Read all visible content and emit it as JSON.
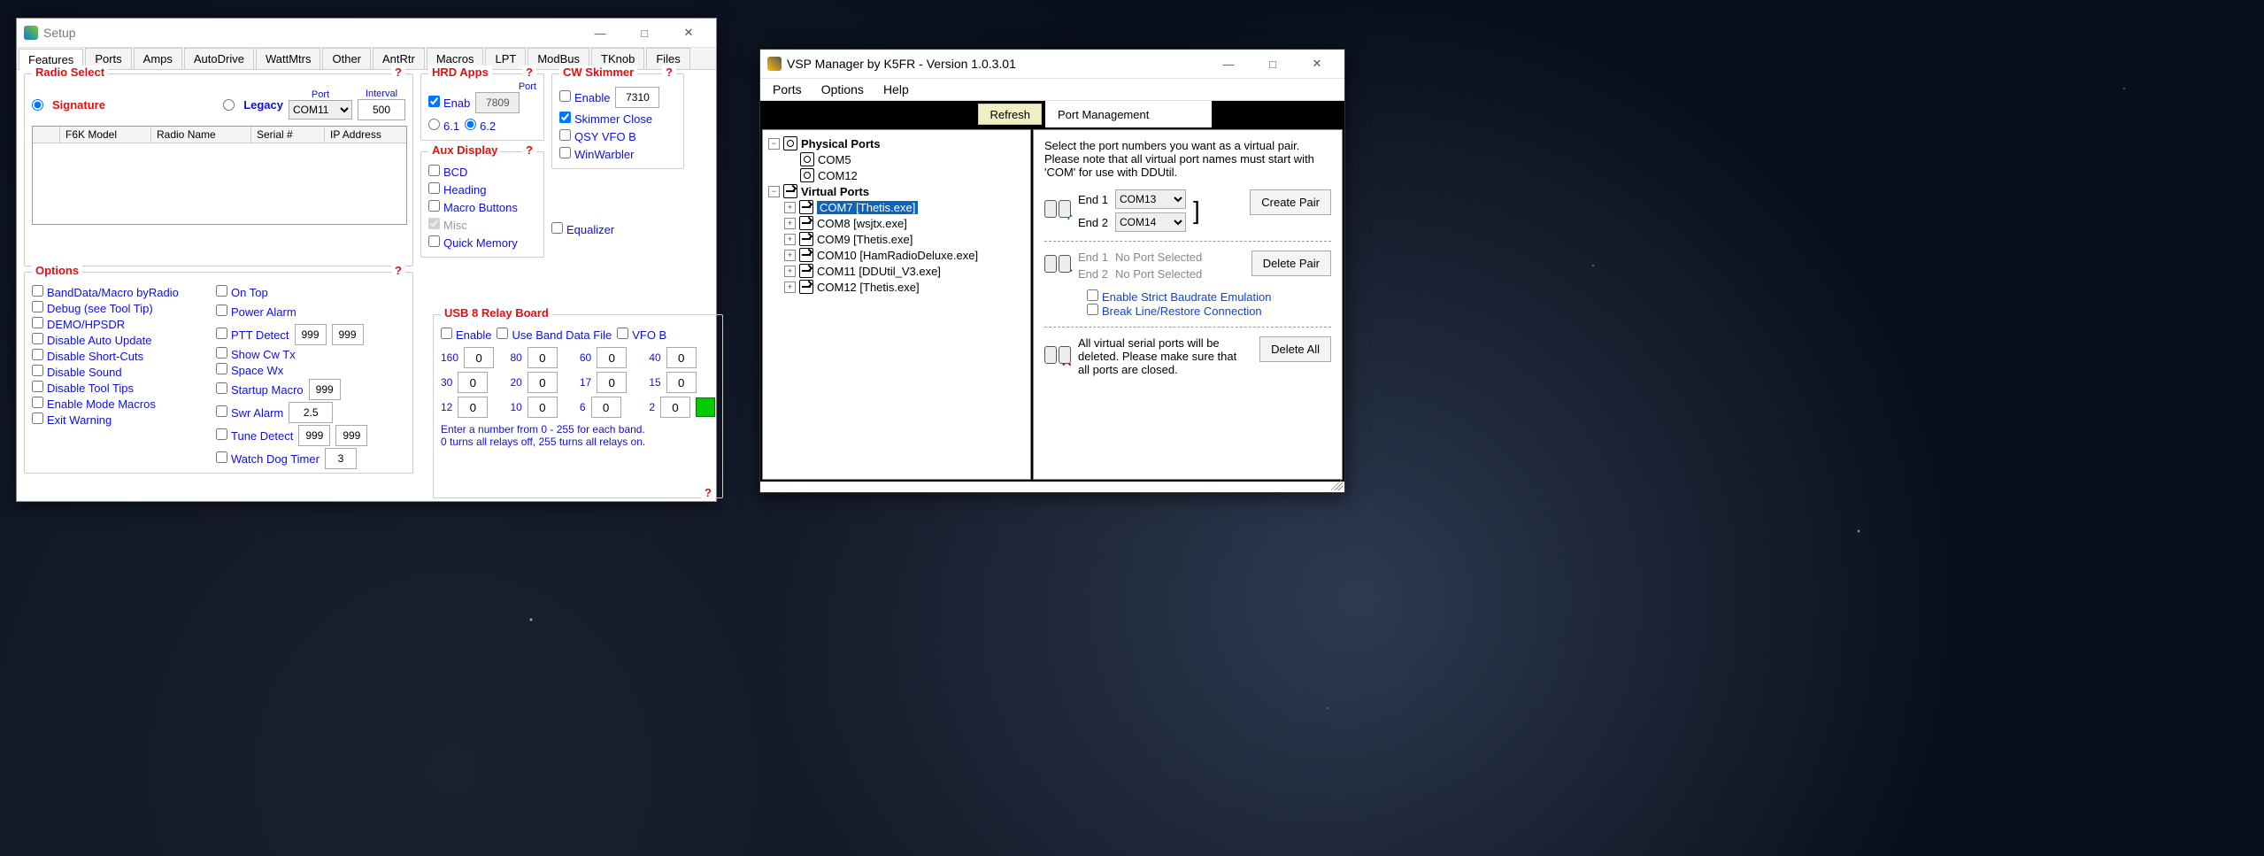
{
  "setup": {
    "title": "Setup",
    "tabs": [
      "Features",
      "Ports",
      "Amps",
      "AutoDrive",
      "WattMtrs",
      "Other",
      "AntRtr",
      "Macros",
      "LPT",
      "ModBus",
      "TKnob",
      "Files"
    ],
    "radio_select": {
      "title": "Radio Select",
      "signature": "Signature",
      "legacy": "Legacy",
      "port_label": "Port",
      "port": "COM11",
      "interval_label": "Interval",
      "interval": "500",
      "table_cols": {
        "col1": "",
        "col2": "F6K Model",
        "col3": "Radio Name",
        "col4": "Serial #",
        "col5": "IP Address"
      }
    },
    "options": {
      "title": "Options",
      "left": [
        "BandData/Macro byRadio",
        "Debug (see Tool Tip)",
        "DEMO/HPSDR",
        "Disable Auto Update",
        "Disable Short-Cuts",
        "Disable Sound",
        "Disable Tool Tips",
        "Enable Mode Macros",
        "Exit Warning"
      ],
      "right": {
        "on_top": "On Top",
        "power_alarm": "Power Alarm",
        "ptt_detect": "PTT Detect",
        "ptt1": "999",
        "ptt2": "999",
        "show_cw": "Show Cw Tx",
        "space_wx": "Space Wx",
        "startup_macro": "Startup Macro",
        "startup_val": "999",
        "swr_alarm": "Swr Alarm",
        "swr_val": "2.5",
        "tune_detect": "Tune Detect",
        "tune1": "999",
        "tune2": "999",
        "watchdog": "Watch Dog Timer",
        "watchdog_val": "3"
      }
    },
    "hrd": {
      "title": "HRD Apps",
      "port_label": "Port",
      "enab": "Enab",
      "port": "7809",
      "v61": "6.1",
      "v62": "6.2"
    },
    "aux": {
      "title": "Aux Display",
      "bcd": "BCD",
      "heading": "Heading",
      "macro_buttons": "Macro Buttons",
      "misc": "Misc",
      "quick_memory": "Quick Memory"
    },
    "usb": {
      "title": "USB 8 Relay Board",
      "enable": "Enable",
      "use_band": "Use Band Data File",
      "vfob": "VFO B",
      "bands": [
        {
          "b": "160",
          "v": "0"
        },
        {
          "b": "80",
          "v": "0"
        },
        {
          "b": "60",
          "v": "0"
        },
        {
          "b": "40",
          "v": "0"
        },
        {
          "b": "30",
          "v": "0"
        },
        {
          "b": "20",
          "v": "0"
        },
        {
          "b": "17",
          "v": "0"
        },
        {
          "b": "15",
          "v": "0"
        },
        {
          "b": "12",
          "v": "0"
        },
        {
          "b": "10",
          "v": "0"
        },
        {
          "b": "6",
          "v": "0"
        },
        {
          "b": "2",
          "v": "0"
        }
      ],
      "hint1": "Enter a number from 0 - 255 for each band.",
      "hint2": "0 turns all relays off, 255 turns all relays on."
    },
    "cw": {
      "title": "CW Skimmer",
      "enable": "Enable",
      "port": "7310",
      "skim_close": "Skimmer Close",
      "qsy": "QSY VFO B",
      "winwarbler": "WinWarbler"
    },
    "equalizer": "Equalizer"
  },
  "vsp": {
    "title": "VSP Manager by K5FR - Version 1.0.3.01",
    "menu": {
      "ports": "Ports",
      "options": "Options",
      "help": "Help"
    },
    "refresh": "Refresh",
    "tab": "Port Management",
    "tree": {
      "physical": "Physical Ports",
      "phys_items": [
        "COM5",
        "COM12"
      ],
      "virtual": "Virtual Ports",
      "virt_items": [
        "COM7 [Thetis.exe]",
        "COM8 [wsjtx.exe]",
        "COM9 [Thetis.exe]",
        "COM10 [HamRadioDeluxe.exe]",
        "COM11 [DDUtil_V3.exe]",
        "COM12 [Thetis.exe]"
      ]
    },
    "right": {
      "instructions": "Select the port numbers you want as a virtual pair. Please note that all virtual port names must start with 'COM' for use with DDUtil.",
      "end1": "End 1",
      "end2": "End 2",
      "end1_val": "COM13",
      "end2_val": "COM14",
      "create": "Create Pair",
      "noport": "No Port Selected",
      "delete_pair": "Delete Pair",
      "strict": "Enable Strict Baudrate Emulation",
      "breakline": "Break Line/Restore Connection",
      "del_all_msg": "All virtual serial ports will be deleted. Please make sure that all ports are closed.",
      "delete_all": "Delete All"
    }
  }
}
